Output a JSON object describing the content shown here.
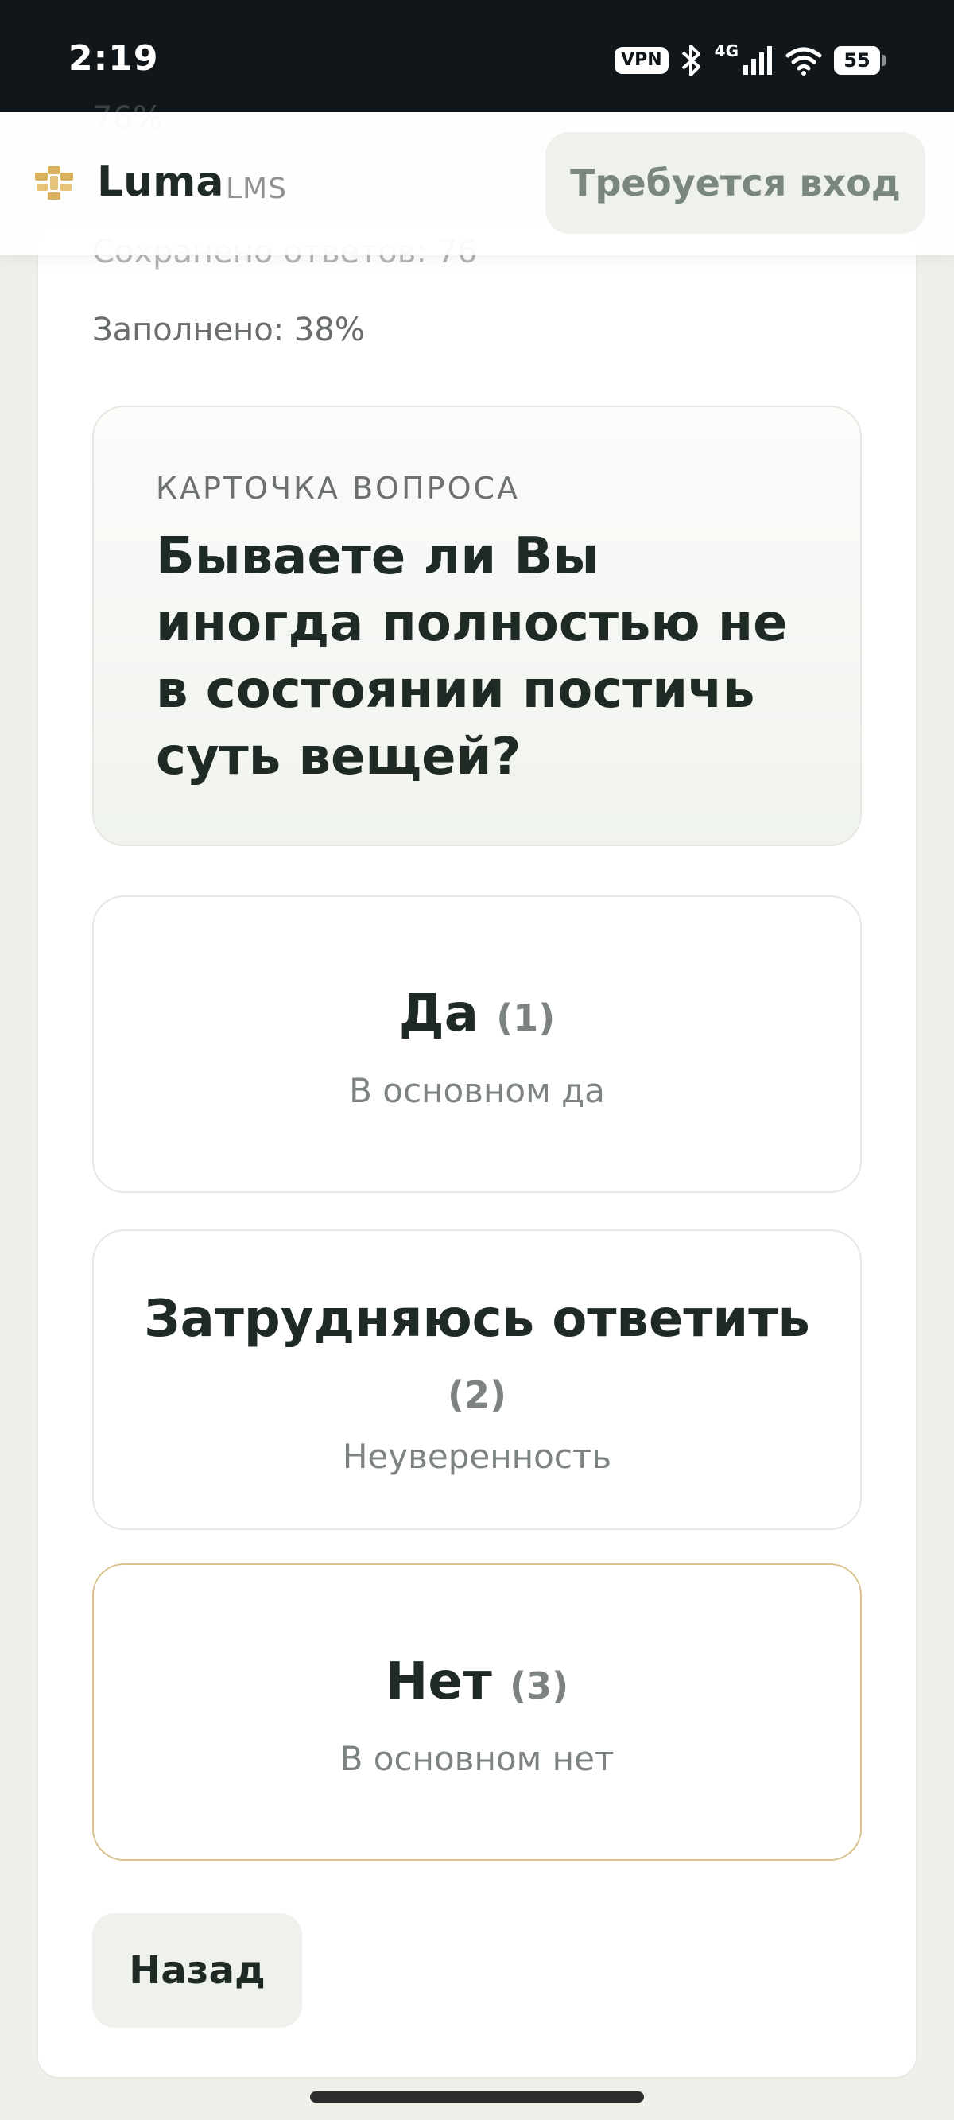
{
  "status_bar": {
    "time": "2:19",
    "vpn": "VPN",
    "network": "4G",
    "battery": "55"
  },
  "header": {
    "brand": "Luma",
    "brand_sub": "LMS",
    "login_label": "Требуется вход"
  },
  "progress": {
    "faded_top": "76%",
    "saved_answers": "Сохранено ответов: 76",
    "filled": "Заполнено: 38%"
  },
  "question": {
    "label": "КАРТОЧКА ВОПРОСА",
    "text": "Бываете ли Вы иногда полностью не в состоянии постичь суть вещей?"
  },
  "options": [
    {
      "title": "Да",
      "num": "(1)",
      "desc": "В основном да",
      "selected": false
    },
    {
      "title": "Затрудняюсь ответить",
      "num": "(2)",
      "desc": "Неуверенность",
      "selected": false
    },
    {
      "title": "Нет",
      "num": "(3)",
      "desc": "В основном нет",
      "selected": true
    }
  ],
  "back_label": "Назад",
  "colors": {
    "accent_border": "#d9c48f",
    "logo_gold": "#d8b15e",
    "text_dark": "#1f2a24"
  }
}
